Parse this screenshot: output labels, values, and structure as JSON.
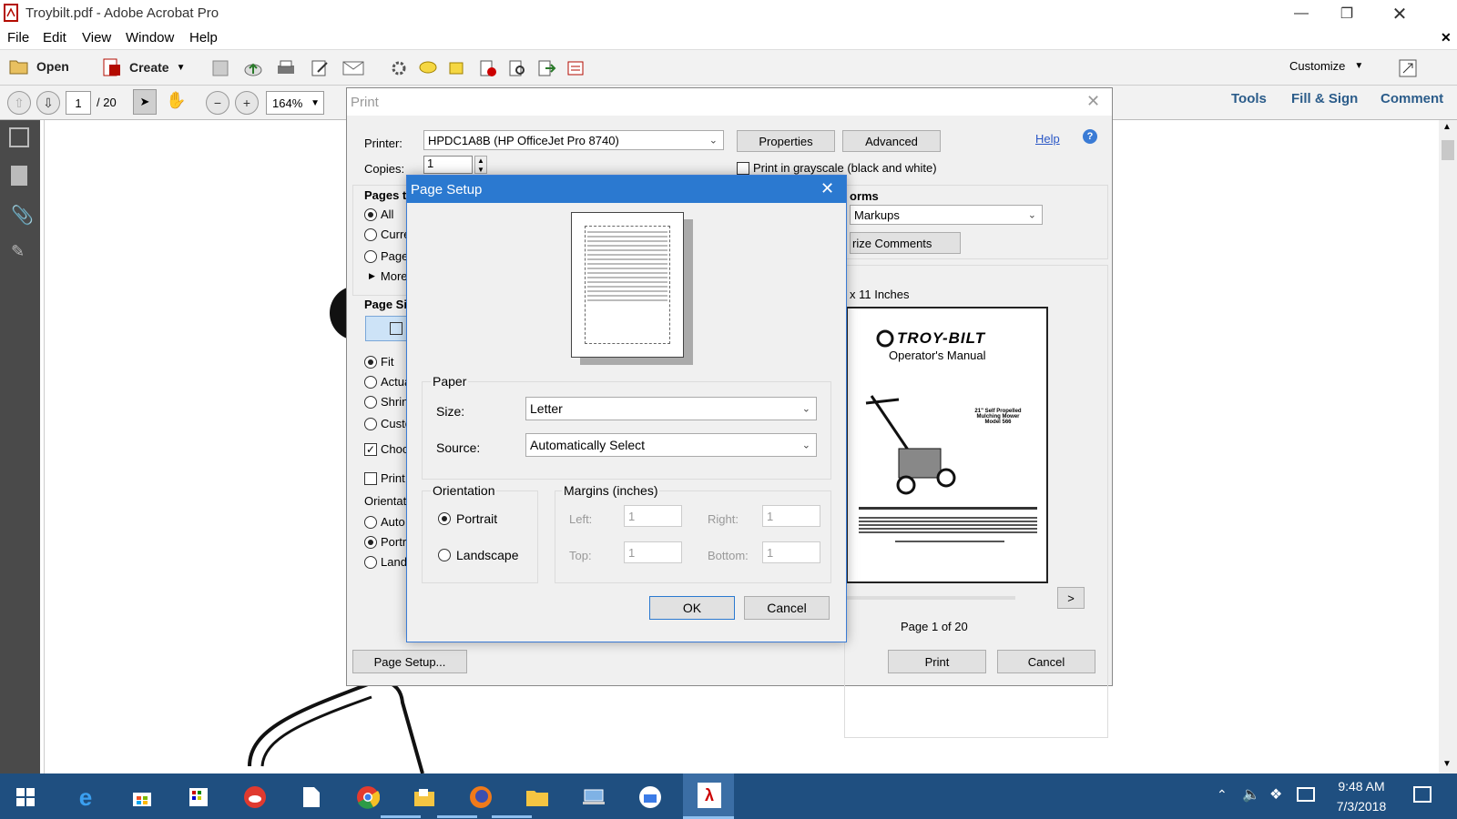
{
  "window": {
    "title": "Troybilt.pdf - Adobe Acrobat Pro"
  },
  "menu": [
    "File",
    "Edit",
    "View",
    "Window",
    "Help"
  ],
  "toolbar": {
    "open": "Open",
    "create": "Create",
    "customize": "Customize"
  },
  "nav": {
    "page": "1",
    "total": "/ 20",
    "zoom": "164%"
  },
  "right_tabs": [
    "Tools",
    "Fill & Sign",
    "Comment"
  ],
  "print": {
    "title": "Print",
    "printer_label": "Printer:",
    "printer_value": "HPDC1A8B (HP OfficeJet Pro 8740)",
    "properties": "Properties",
    "advanced": "Advanced",
    "help": "Help",
    "copies_label": "Copies:",
    "copies_value": "1",
    "grayscale": "Print in grayscale (black and white)",
    "pages_to": "Pages to",
    "all": "All",
    "current": "Curre",
    "pages": "Pages",
    "more": "More",
    "page_size": "Page Siz",
    "fit": "Fit",
    "actual": "Actua",
    "shrink": "Shrin",
    "custom": "Custo",
    "choose": "Choo",
    "print_on": "Print",
    "orientation": "Orientati",
    "auto": "Auto",
    "portrait": "Portra",
    "landscape": "Lands",
    "forms": "orms",
    "markups": "Markups",
    "summarize": "rize Comments",
    "paper_size": "x 11 Inches",
    "page_of": "Page 1 of 20",
    "next": ">",
    "page_setup_btn": "Page Setup...",
    "print_btn": "Print",
    "cancel_btn": "Cancel"
  },
  "preview": {
    "brand": "TROY-BILT",
    "manual": "Operator's Manual",
    "model_lines": [
      "21\" Self Propelled",
      "Mulching Mower",
      "Model 566"
    ],
    "registered": "®"
  },
  "page_setup": {
    "title": "Page Setup",
    "paper": "Paper",
    "size_label": "Size:",
    "size_value": "Letter",
    "source_label": "Source:",
    "source_value": "Automatically Select",
    "orientation": "Orientation",
    "portrait": "Portrait",
    "landscape": "Landscape",
    "margins": "Margins (inches)",
    "left": "Left:",
    "right": "Right:",
    "top": "Top:",
    "bottom": "Bottom:",
    "left_v": "1",
    "right_v": "1",
    "top_v": "1",
    "bottom_v": "1",
    "ok": "OK",
    "cancel": "Cancel"
  },
  "taskbar": {
    "time": "9:48 AM",
    "date": "7/3/2018"
  }
}
